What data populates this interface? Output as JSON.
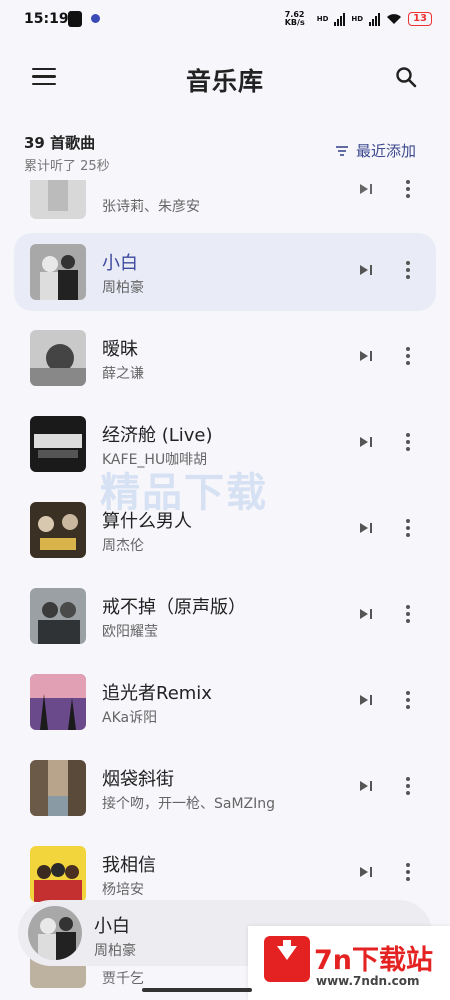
{
  "status_bar": {
    "time": "15:19",
    "net_speed": "7.62 KB/s",
    "sig1": "HD",
    "sig2": "HD",
    "battery": "13"
  },
  "app_bar": {
    "title": "音乐库",
    "menu_icon": "menu-icon",
    "search_icon": "search-icon"
  },
  "library": {
    "song_count": "39 首歌曲",
    "listened": "累计听了 25秒",
    "sort_label": "最近添加"
  },
  "songs": [
    {
      "title": "",
      "artist": "张诗莉、朱彦安"
    },
    {
      "title": "小白",
      "artist": "周柏豪",
      "active": true
    },
    {
      "title": "暧昧",
      "artist": "薛之谦"
    },
    {
      "title": "经济舱 (Live)",
      "artist": "KAFE_HU咖啡胡"
    },
    {
      "title": "算什么男人",
      "artist": "周杰伦"
    },
    {
      "title": "戒不掉（原声版）",
      "artist": "欧阳耀莹"
    },
    {
      "title": "追光者Remix",
      "artist": "AKa诉阳"
    },
    {
      "title": "烟袋斜街",
      "artist": "接个吻，开一枪、SaMZIng"
    },
    {
      "title": "我相信",
      "artist": "杨培安"
    },
    {
      "title": "",
      "artist": "贾千乞"
    }
  ],
  "mini_player": {
    "title": "小白",
    "artist": "周柏豪"
  },
  "watermark": {
    "name": "7n下载站",
    "url": "www.7ndn.com",
    "faint": "精品下载"
  },
  "colors": {
    "accent": "#3d4aa0",
    "active_row_bg": "#e9ebf7",
    "watermark_red": "#e52222"
  }
}
